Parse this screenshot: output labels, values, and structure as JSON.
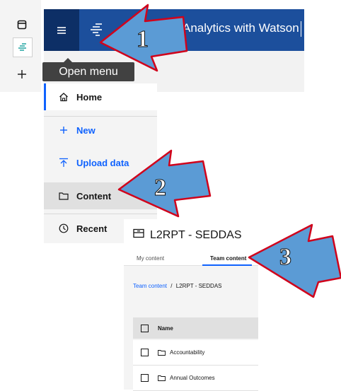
{
  "app": {
    "title": "Analytics with Watson"
  },
  "tooltip": {
    "text": "Open menu"
  },
  "rail": {
    "icons": [
      "panel-icon",
      "analytics-icon",
      "plus-icon"
    ]
  },
  "sidemenu": {
    "items": [
      {
        "label": "Home",
        "icon": "home-icon"
      },
      {
        "label": "New",
        "icon": "plus-icon"
      },
      {
        "label": "Upload data",
        "icon": "upload-icon"
      },
      {
        "label": "Content",
        "icon": "folder-icon"
      },
      {
        "label": "Recent",
        "icon": "clock-icon"
      }
    ]
  },
  "content_panel": {
    "title": "L2RPT - SEDDAS",
    "tabs": [
      {
        "label": "My content"
      },
      {
        "label": "Team content"
      }
    ],
    "breadcrumb": {
      "root": "Team content",
      "separator": "/",
      "current": "L2RPT - SEDDAS"
    },
    "table": {
      "header": "Name",
      "rows": [
        {
          "name": "Accountability"
        },
        {
          "name": "Annual Outcomes"
        }
      ]
    }
  },
  "callouts": [
    "1",
    "2",
    "3"
  ],
  "colors": {
    "topbar": "#1c4f9c",
    "accent": "#0f62fe",
    "arrow_fill": "#5b9bd5",
    "arrow_stroke": "#d0021b"
  }
}
